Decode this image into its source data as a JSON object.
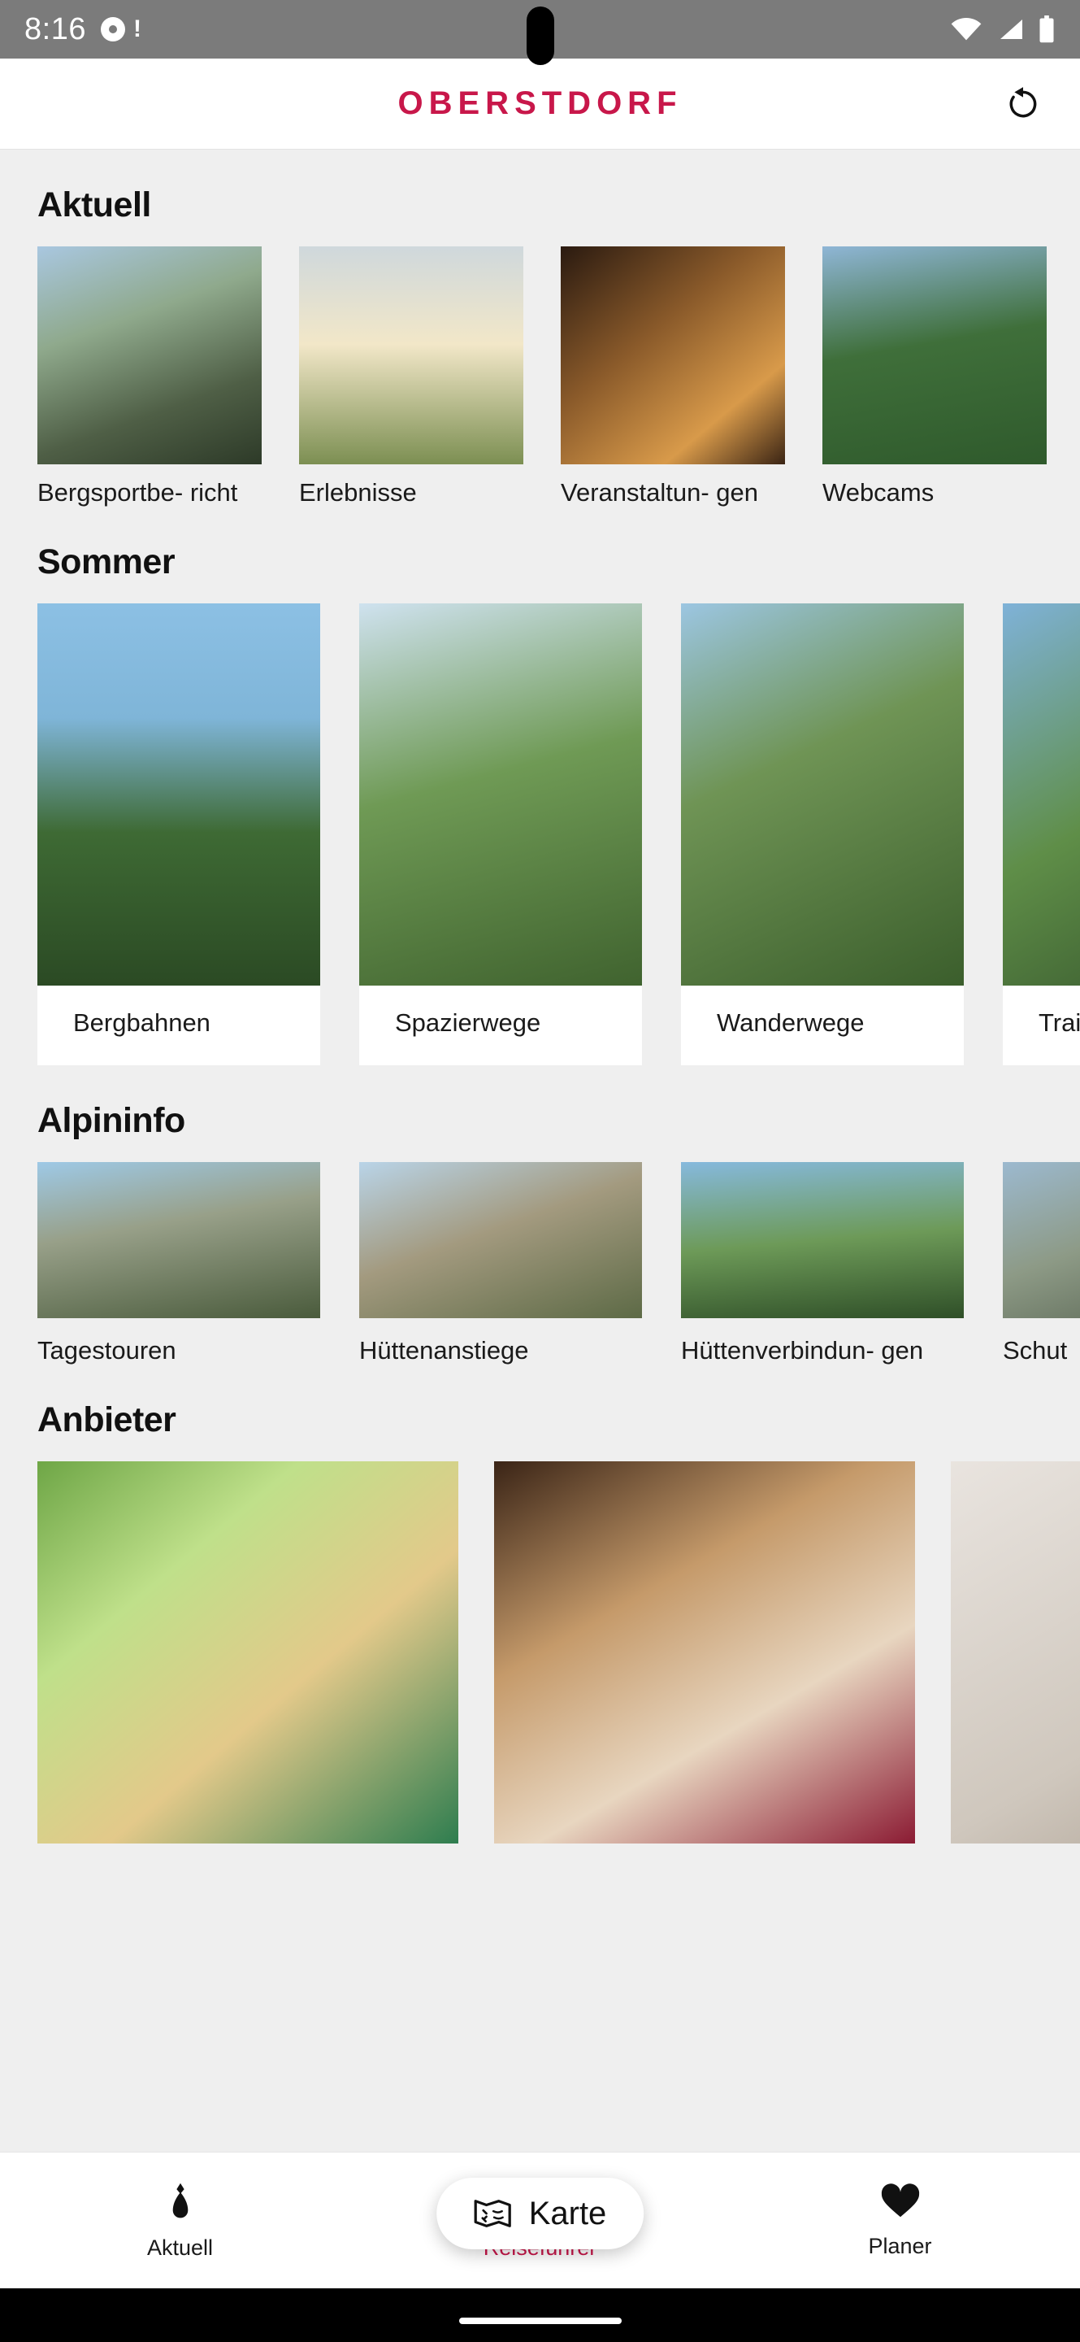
{
  "status_bar": {
    "time": "8:16",
    "notification_icon": "message-dot-icon",
    "wifi_icon": "wifi-icon",
    "signal_icon": "signal-bars-icon",
    "battery_icon": "battery-icon"
  },
  "header": {
    "logo_text": "OBERSTDORF",
    "brand_color": "#C8174A",
    "refresh_icon": "refresh-icon"
  },
  "sections": [
    {
      "title": "Aktuell",
      "layout": "tiles",
      "items": [
        {
          "label": "Bergsportbe-\nricht"
        },
        {
          "label": "Erlebnisse"
        },
        {
          "label": "Veranstaltun-\ngen"
        },
        {
          "label": "Webcams"
        }
      ]
    },
    {
      "title": "Sommer",
      "layout": "cards",
      "items": [
        {
          "label": "Bergbahnen"
        },
        {
          "label": "Spazierwege"
        },
        {
          "label": "Wanderwege"
        },
        {
          "label": "Trail\nStre"
        }
      ]
    },
    {
      "title": "Alpininfo",
      "layout": "tiles",
      "items": [
        {
          "label": "Tagestouren"
        },
        {
          "label": "Hüttenanstiege"
        },
        {
          "label": "Hüttenverbindun-\ngen"
        },
        {
          "label": "Schut"
        }
      ]
    },
    {
      "title": "Anbieter",
      "layout": "wide",
      "items": [
        {
          "label": ""
        },
        {
          "label": ""
        },
        {
          "label": ""
        }
      ]
    }
  ],
  "map_button": {
    "label": "Karte",
    "icon": "map-folded-icon"
  },
  "bottom_nav": {
    "active_color": "#C8174A",
    "items": [
      {
        "label": "Aktuell",
        "icon": "flame-icon",
        "active": false
      },
      {
        "label": "Reiseführer",
        "icon": "grid-icon",
        "active": true
      },
      {
        "label": "Planer",
        "icon": "heart-icon",
        "active": false
      }
    ]
  }
}
